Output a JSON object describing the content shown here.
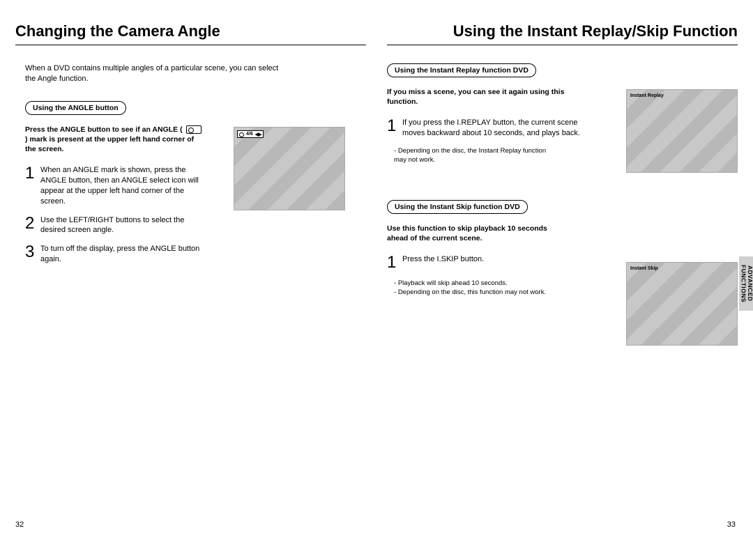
{
  "left": {
    "title": "Changing the Camera Angle",
    "intro": "When a DVD contains multiple angles of a particular scene, you can select the Angle function.",
    "pill": "Using the ANGLE button",
    "instruction_a": "Press the ANGLE button to see if an ANGLE",
    "instruction_b": "mark is present at the upper left hand corner of the screen.",
    "steps": [
      "When an ANGLE mark is shown, press the ANGLE button, then an ANGLE select icon will appear at the upper left hand corner of the screen.",
      "Use the LEFT/RIGHT buttons to select the desired screen angle.",
      "To turn off the display, press the ANGLE button again."
    ],
    "angle_badge": "4/6",
    "page_num": "32"
  },
  "right": {
    "title": "Using the Instant Replay/Skip Function",
    "replay": {
      "pill": "Using the Instant Replay function DVD",
      "instruction": "If you miss a scene, you can see it again using this function.",
      "step1": "If you press the I.REPLAY button, the current scene moves backward about 10 seconds, and plays back.",
      "note": "Depending on the disc, the Instant Replay function may not work.",
      "shot_label": "Instant Replay"
    },
    "skip": {
      "pill": "Using the Instant Skip function DVD",
      "instruction": "Use this function to skip playback 10 seconds ahead of the current scene.",
      "step1": "Press the I.SKIP button.",
      "notes": [
        "Playback will skip ahead 10 seconds.",
        "Depending on the disc, this function may not work."
      ],
      "shot_label": "Instant Skip"
    },
    "side_tab": "ADVANCED FUNCTIONS",
    "page_num": "33"
  }
}
